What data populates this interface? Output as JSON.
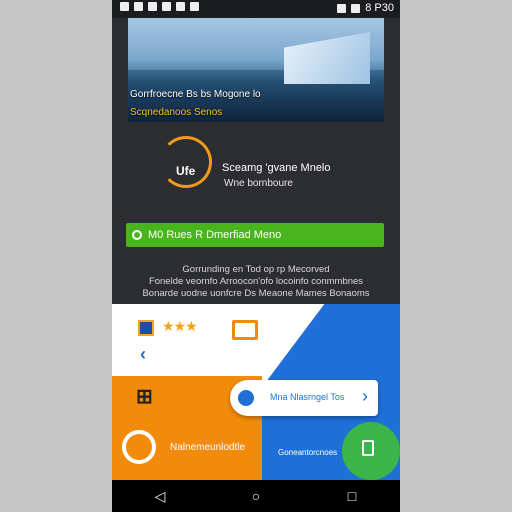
{
  "status_bar": {
    "left_icons": [
      "notification-icon",
      "image-icon",
      "cloud-icon",
      "cloud-icon",
      "cloud-icon",
      "cloud-icon"
    ],
    "right_text": "8 P30",
    "right_icons": [
      "bluetooth-icon",
      "wifi-icon",
      "battery-icon"
    ]
  },
  "hero": {
    "line1": "Gorrfroecne Bs bs Mogone lo",
    "line2": "Scqnedanoos Senos"
  },
  "brand": {
    "logo_text": "Ufe",
    "name": "Sceamg 'gvane Mnelo",
    "tagline": "Wne bornboure"
  },
  "cta_label": "M0 Rues R Dmerfiad Meno",
  "description": {
    "line1": "Gorrunding en Tod op rp Mecorved",
    "line2": "Fonelde veornfo Arroocon'ofo locoinfo conmmbnes",
    "line3": "Bonarde uodne uonfcre Ds Meaone Mames Bonaoms"
  },
  "promo": {
    "pill_label": "Mna Nlasrngel Tos",
    "footer_label1": "Nalnemeunlodtle",
    "footer_label2": "Goneantorcnoes"
  },
  "colors": {
    "accent_green": "#47b51b",
    "accent_orange": "#f28b0c",
    "accent_blue": "#1f6fd6",
    "background": "#2c2d30"
  },
  "nav": {
    "back_glyph": "◁",
    "home_glyph": "○",
    "recents_glyph": "□"
  }
}
